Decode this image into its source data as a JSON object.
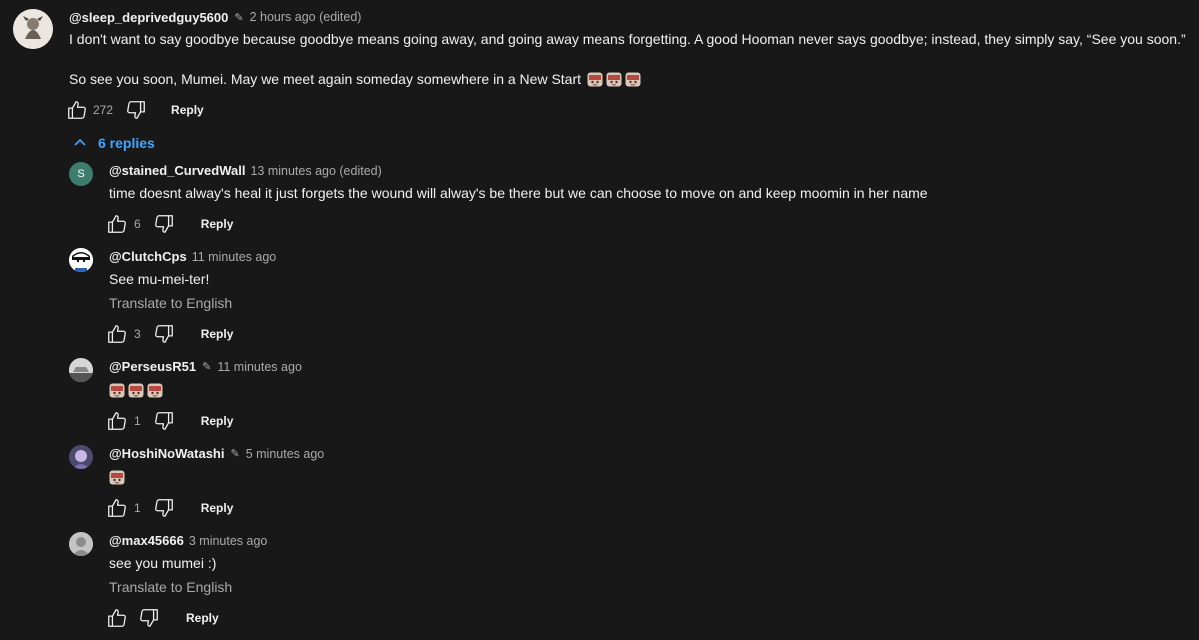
{
  "comments": [
    {
      "handle": "@sleep_deprivedguy5600",
      "time": "2 hours ago (edited)",
      "text_line1": "I don't want to say goodbye because goodbye means going away, and going away means forgetting. A good Hooman never says goodbye; instead, they simply say, “See you soon.”",
      "text_line2": "So see you soon, Mumei. May we meet again someday somewhere in a New Start",
      "likes": "272",
      "reply_label": "Reply"
    }
  ],
  "replies_toggle": "6 replies",
  "replies": [
    {
      "handle": "@stained_CurvedWall",
      "time": "13 minutes ago (edited)",
      "avatar_letter": "S",
      "text": "time doesnt alway's heal it just forgets the wound will alway's be there but we can choose to move on and keep moomin in her name",
      "likes": "6",
      "reply_label": "Reply"
    },
    {
      "handle": "@ClutchCps",
      "time": "11 minutes ago",
      "text": "See mu-mei-ter!",
      "translate": "Translate to English",
      "likes": "3",
      "reply_label": "Reply"
    },
    {
      "handle": "@PerseusR51",
      "time": "11 minutes ago",
      "likes": "1",
      "reply_label": "Reply"
    },
    {
      "handle": "@HoshiNoWatashi",
      "time": "5 minutes ago",
      "likes": "1",
      "reply_label": "Reply"
    },
    {
      "handle": "@max45666",
      "time": "3 minutes ago",
      "text": "see you mumei :)",
      "translate": "Translate to English",
      "reply_label": "Reply"
    }
  ],
  "colors": {
    "background": "#181818",
    "link_blue": "#3ea6ff",
    "text": "#f1f1f1",
    "muted": "#aaaaaa"
  }
}
